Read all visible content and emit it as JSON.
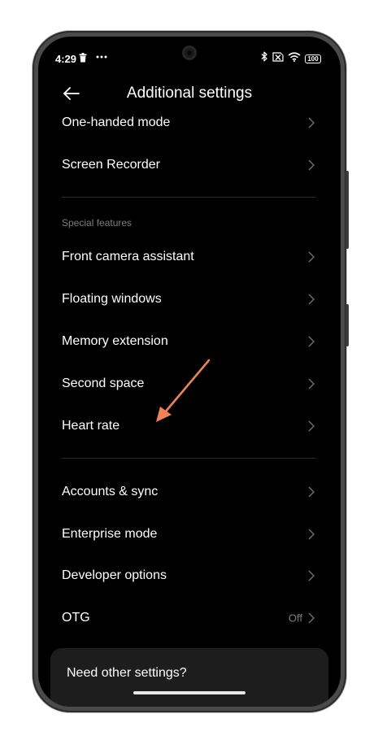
{
  "status_bar": {
    "time": "4:29",
    "notification_icons": [
      "trash-icon",
      "more-dots-icon"
    ],
    "system_icons": [
      "bluetooth-icon",
      "sim-off-icon",
      "wifi-icon"
    ],
    "battery": "100"
  },
  "header": {
    "title": "Additional settings",
    "back_icon": "back-arrow-icon"
  },
  "group_top": [
    {
      "label": "One-handed mode"
    },
    {
      "label": "Screen Recorder"
    }
  ],
  "special_features": {
    "header": "Special features",
    "items": [
      {
        "label": "Front camera assistant"
      },
      {
        "label": "Floating windows"
      },
      {
        "label": "Memory extension"
      },
      {
        "label": "Second space"
      },
      {
        "label": "Heart rate"
      }
    ]
  },
  "group_bottom": [
    {
      "label": "Accounts & sync"
    },
    {
      "label": "Enterprise mode"
    },
    {
      "label": "Developer options"
    },
    {
      "label": "OTG",
      "value": "Off"
    }
  ],
  "bottom_card": {
    "label": "Need other settings?"
  },
  "annotation": {
    "icon": "pointer-arrow-icon",
    "color": "#f0825a",
    "target": "Heart rate"
  },
  "colors": {
    "background": "#000000",
    "text_primary": "#ffffff",
    "text_secondary": "#7c7c7c",
    "card": "#1d1d1d"
  }
}
